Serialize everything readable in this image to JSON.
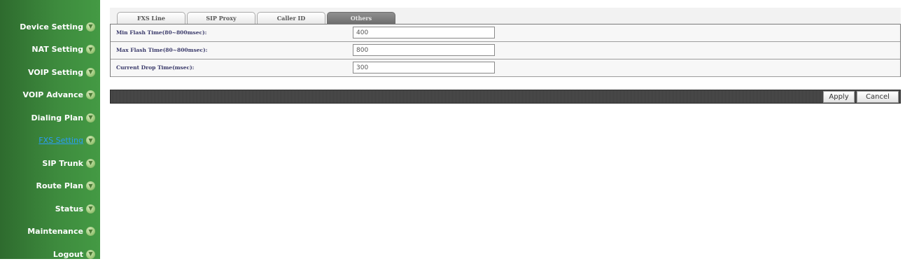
{
  "sidebar": {
    "items": [
      {
        "label": "Device Setting",
        "active": false
      },
      {
        "label": "NAT Setting",
        "active": false
      },
      {
        "label": "VOIP Setting",
        "active": false
      },
      {
        "label": "VOIP Advance",
        "active": false
      },
      {
        "label": "Dialing Plan",
        "active": false
      },
      {
        "label": "FXS Setting",
        "active": true
      },
      {
        "label": "SIP Trunk",
        "active": false
      },
      {
        "label": "Route Plan",
        "active": false
      },
      {
        "label": "Status",
        "active": false
      },
      {
        "label": "Maintenance",
        "active": false
      },
      {
        "label": "Logout",
        "active": false
      }
    ],
    "icon": "arrow-circle-icon",
    "colors": {
      "background": "#3d8a3d",
      "active_text": "#2a9df4"
    }
  },
  "tabs": [
    {
      "label": "FXS Line",
      "active": false
    },
    {
      "label": "SIP Proxy",
      "active": false
    },
    {
      "label": "Caller ID",
      "active": false
    },
    {
      "label": "Others",
      "active": true
    }
  ],
  "form": {
    "rows": [
      {
        "label": "Min Flash Time(80~800msec):",
        "value": "400"
      },
      {
        "label": "Max Flash Time(80~800msec):",
        "value": "800"
      },
      {
        "label": "Current Drop Time(msec):",
        "value": "300"
      }
    ]
  },
  "actions": {
    "apply_label": "Apply",
    "cancel_label": "Cancel"
  }
}
